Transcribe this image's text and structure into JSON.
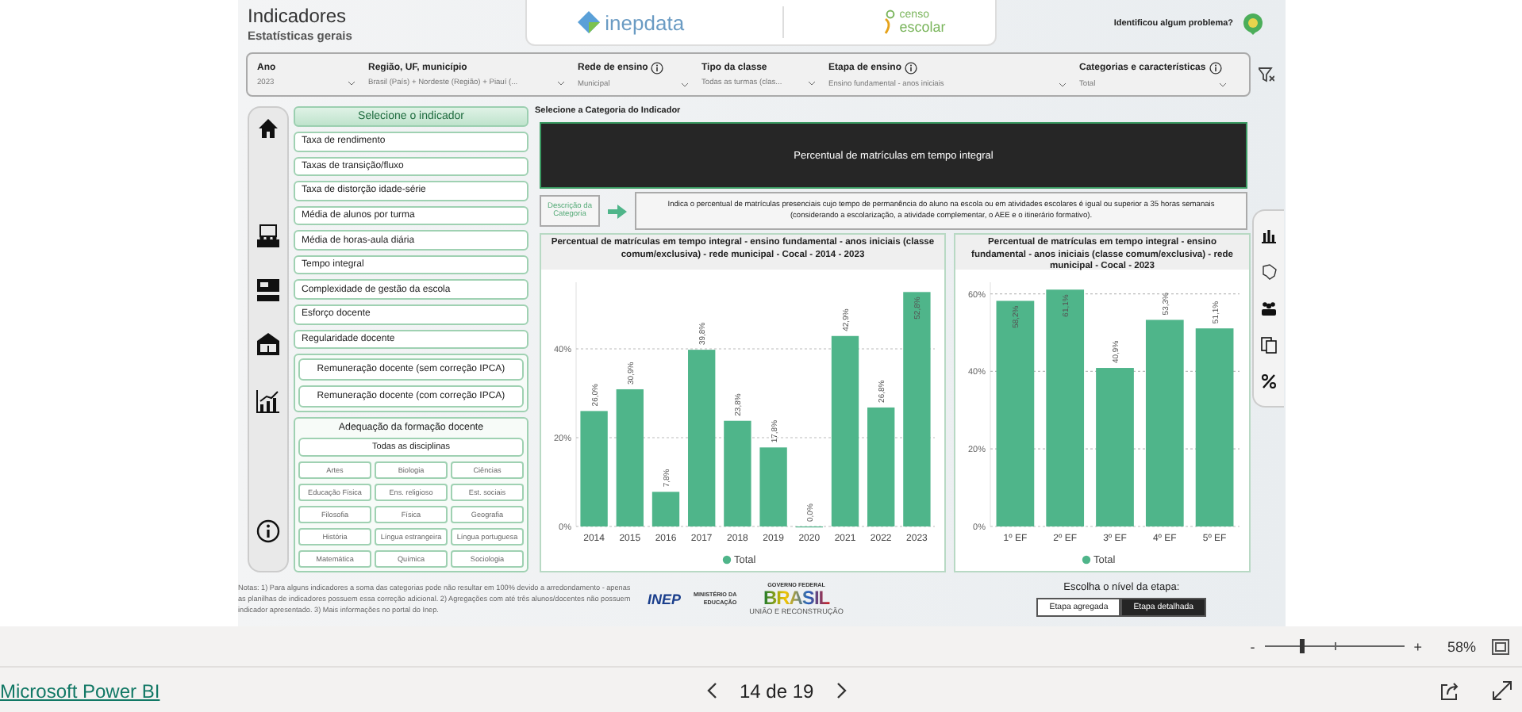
{
  "header": {
    "title": "Indicadores",
    "subtitle": "Estatísticas gerais",
    "logo_1": "inepdata",
    "logo_2": [
      "censo",
      "escolar"
    ],
    "report_problem": "Identificou algum problema?"
  },
  "filters": [
    {
      "label": "Ano",
      "value": "2023",
      "info": false
    },
    {
      "label": "Região, UF, município",
      "value": "Brasil (País) + Nordeste (Região) + Piauí (...",
      "info": false
    },
    {
      "label": "Rede de ensino",
      "value": "Municipal",
      "info": true
    },
    {
      "label": "Tipo da classe",
      "value": "Todas as turmas (clas...",
      "info": false
    },
    {
      "label": "Etapa de ensino",
      "value": "Ensino fundamental - anos iniciais",
      "info": true
    },
    {
      "label": "Categorias e características",
      "value": "Total",
      "info": true
    }
  ],
  "indicators": {
    "title": "Selecione o indicador",
    "items": [
      "Taxa de rendimento",
      "Taxas de transição/fluxo",
      "Taxa de distorção idade-série",
      "Média de alunos por turma",
      "Média de horas-aula diária",
      "Tempo integral",
      "Complexidade de gestão da escola",
      "Esforço docente",
      "Regularidade docente"
    ],
    "remuneration": [
      "Remuneração docente (sem correção IPCA)",
      "Remuneração docente (com correção IPCA)"
    ],
    "formation": {
      "title": "Adequação da formação docente",
      "all": "Todas as disciplinas",
      "subjects": [
        "Artes",
        "Biologia",
        "Ciências",
        "Educação Física",
        "Ens. religioso",
        "Est. sociais",
        "Filosofia",
        "Física",
        "Geografia",
        "História",
        "Língua estrangeira",
        "Língua portuguesa",
        "Matemática",
        "Química",
        "Sociologia"
      ]
    }
  },
  "content": {
    "category_prompt": "Selecione a Categoria do Indicador",
    "category_title": "Percentual de matrículas em tempo integral",
    "description_label": "Descrição da Categoria",
    "description": "Indica o percentual de matrículas presenciais cujo tempo de permanência do aluno na escola ou em atividades escolares é igual ou superior a 35 horas semanais (considerando a escolarização, a atividade complementar, o AEE e o itinerário formativo).",
    "charts": [
      {
        "chart_data": {
          "type": "bar",
          "title": "Percentual de matrículas em tempo integral - ensino fundamental - anos iniciais (classe comum/exclusiva) - rede municipal - Cocal - 2014 - 2023",
          "categories": [
            "2014",
            "2015",
            "2016",
            "2017",
            "2018",
            "2019",
            "2020",
            "2021",
            "2022",
            "2023"
          ],
          "series": [
            {
              "name": "Total",
              "color": "#4fb58a",
              "values": [
                26.0,
                30.9,
                7.8,
                39.8,
                23.8,
                17.8,
                0.0,
                42.9,
                26.8,
                52.8
              ]
            }
          ],
          "ylim": [
            0,
            55
          ],
          "yticks": [
            {
              "value": 0,
              "label": "0%"
            },
            {
              "value": 20,
              "label": "20%"
            },
            {
              "value": 40,
              "label": "40%"
            }
          ],
          "grid": true,
          "value_labels": [
            "26,0%",
            "30,9%",
            "7,8%",
            "39,8%",
            "23,8%",
            "17,8%",
            "0,0%",
            "42,9%",
            "26,8%",
            "52,8%"
          ]
        }
      },
      {
        "chart_data": {
          "type": "bar",
          "title": "Percentual de matrículas em tempo integral - ensino fundamental - anos iniciais (classe comum/exclusiva) - rede municipal - Cocal - 2023",
          "categories": [
            "1º EF",
            "2º EF",
            "3º EF",
            "4º EF",
            "5º EF"
          ],
          "series": [
            {
              "name": "Total",
              "color": "#4fb58a",
              "values": [
                58.2,
                61.1,
                40.9,
                53.3,
                51.1
              ]
            }
          ],
          "ylim": [
            0,
            63
          ],
          "yticks": [
            {
              "value": 0,
              "label": "0%"
            },
            {
              "value": 20,
              "label": "20%"
            },
            {
              "value": 40,
              "label": "40%"
            },
            {
              "value": 60,
              "label": "60%"
            }
          ],
          "grid": true,
          "value_labels": [
            "58,2%",
            "61,1%",
            "40,9%",
            "53,3%",
            "51,1%"
          ]
        }
      }
    ]
  },
  "notes": {
    "text": "Notas: 1) Para alguns indicadores a soma das categorias pode não resultar em 100% devido a arredondamento - apenas as planilhas de indicadores possuem essa correção adicional. 2) Agregações com até três alunos/docentes não possuem indicador apresentado. 3) Mais informações no",
    "link": "portal do Inep."
  },
  "logos": {
    "inep": "INEP",
    "ministry": [
      "MINISTÉRIO DA",
      "EDUCAÇÃO"
    ],
    "government": "GOVERNO FEDERAL",
    "brasil": "BRASIL",
    "motto": "UNIÃO E RECONSTRUÇÃO"
  },
  "stage": {
    "label": "Escolha o nível da etapa:",
    "options": [
      {
        "label": "Etapa agregada",
        "selected": false
      },
      {
        "label": "Etapa detalhada",
        "selected": true
      }
    ]
  },
  "zoom": {
    "minus": "-",
    "plus": "+",
    "level": 0.26,
    "reading": "58%"
  },
  "footer": {
    "brand": "Microsoft Power BI",
    "page": "14 de 19"
  }
}
